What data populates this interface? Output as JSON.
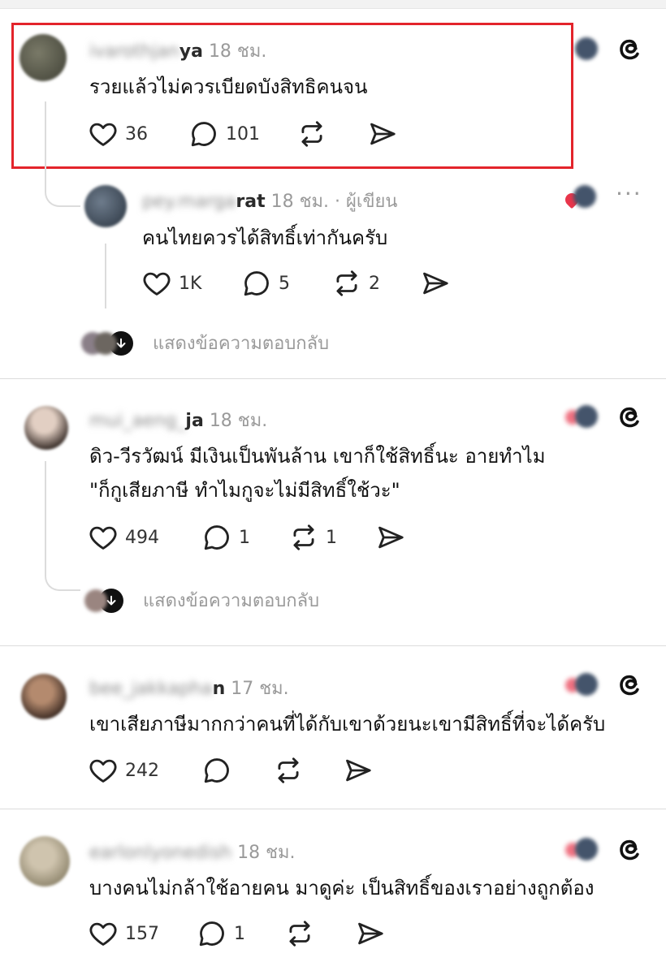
{
  "colors": {
    "highlight_border": "#e3242b",
    "heart_red": "#e8354b"
  },
  "icons": {
    "like": "heart-icon",
    "reply": "comment-icon",
    "repost": "repost-icon",
    "share": "send-icon",
    "logo": "threads-logo-icon"
  },
  "comments": [
    {
      "username_blurred": "ivarothjan",
      "username_visible": "ya",
      "time": "18 ชม.",
      "text": "รวยแล้วไม่ควรเบียดบังสิทธิคนจน",
      "likes": "36",
      "replies": "101",
      "reposts": ""
    },
    {
      "username_blurred": "pey.marga",
      "username_visible": "rat",
      "time": "18 ชม.",
      "author_tag": "· ผู้เขียน",
      "text": "คนไทยควรได้สิทธิ์เท่ากันครับ",
      "likes": "1K",
      "replies": "5",
      "reposts": "2",
      "show_replies": "แสดงข้อความตอบกลับ"
    },
    {
      "username_blurred": "mui_aeng_",
      "username_visible": "ja",
      "time": "18 ชม.",
      "text_line1": "ดิว-วีรวัฒน์ มีเงินเป็นพันล้าน เขาก็ใช้สิทธิ์นะ อายทำไม",
      "text_line2": "\"ก็กูเสียภาษี ทำไมกูจะไม่มีสิทธิ์ใช้วะ\"",
      "likes": "494",
      "replies": "1",
      "reposts": "1",
      "show_replies": "แสดงข้อความตอบกลับ"
    },
    {
      "username_blurred": "bee_jakkapha",
      "username_visible": "n",
      "time": "17 ชม.",
      "text": "เขาเสียภาษีมากกว่าคนที่ได้กับเขาด้วยนะเขามีสิทธิ์ที่จะได้ครับ",
      "likes": "242",
      "replies": "",
      "reposts": ""
    },
    {
      "username_blurred": "earlonlyonedish",
      "username_visible": "",
      "time": "18 ชม.",
      "text": "บางคนไม่กล้าใช้อายคน มาดูค่ะ เป็นสิทธิ์ของเราอย่างถูกต้อง",
      "likes": "157",
      "replies": "1",
      "reposts": ""
    }
  ]
}
